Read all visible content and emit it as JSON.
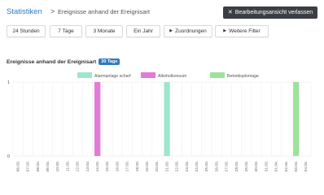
{
  "breadcrumb": {
    "root": "Statistiken",
    "separator": ">",
    "current": "Ereignisse anhand der Ereignisart"
  },
  "exit_button": {
    "icon": "close-icon",
    "label": "Bearbeitungsansicht verlassen"
  },
  "filters": [
    {
      "label": "24 Stunden"
    },
    {
      "label": "7 Tage"
    },
    {
      "label": "3 Monate"
    },
    {
      "label": "Ein Jahr"
    },
    {
      "label": "Zuordnungen",
      "icon": "caret-right-icon"
    },
    {
      "label": "Weitere Filter",
      "icon": "caret-right-icon"
    }
  ],
  "section": {
    "title": "Ereignisse anhand der Ereignisart",
    "badge": "30 Tage"
  },
  "colors": {
    "accent": "#2f7bbf",
    "dark_button": "#3b3f44",
    "grid": "#e6e6e6"
  },
  "chart_data": {
    "type": "bar",
    "title": "",
    "xlabel": "",
    "ylabel": "",
    "ylim": [
      0,
      1
    ],
    "yticks": [
      "0",
      "1"
    ],
    "legend_position": "top-center",
    "categories": [
      "06.03.",
      "07.03.",
      "08.03.",
      "09.03.",
      "10.03.",
      "11.03.",
      "12.03.",
      "13.03.",
      "14.03.",
      "15.03.",
      "16.03.",
      "17.03.",
      "18.03.",
      "19.03.",
      "20.03.",
      "21.03.",
      "22.03.",
      "23.03.",
      "24.03.",
      "25.03.",
      "26.03.",
      "27.03.",
      "28.03.",
      "29.03.",
      "30.03.",
      "31.03.",
      "01.04.",
      "02.04.",
      "03.04.",
      "04.04."
    ],
    "series": [
      {
        "name": "Alarmanlage scharf",
        "color": "#9ee6cc",
        "values": [
          0,
          0,
          0,
          0,
          0,
          0,
          0,
          0,
          0,
          0,
          0,
          0,
          0,
          0,
          0,
          1,
          0,
          0,
          0,
          0,
          0,
          0,
          0,
          0,
          0,
          0,
          0,
          0,
          0,
          0
        ]
      },
      {
        "name": "Alkoholkonsum",
        "color": "#e27ad6",
        "values": [
          0,
          0,
          0,
          0,
          0,
          0,
          0,
          0,
          1,
          0,
          0,
          0,
          0,
          0,
          0,
          0,
          0,
          0,
          0,
          0,
          0,
          0,
          0,
          0,
          0,
          0,
          0,
          0,
          0,
          0
        ]
      },
      {
        "name": "Betreibsplomage",
        "color": "#9be39a",
        "values": [
          0,
          0,
          0,
          0,
          0,
          0,
          0,
          0,
          0,
          0,
          0,
          0,
          0,
          0,
          0,
          0,
          0,
          0,
          0,
          0,
          0,
          0,
          0,
          0,
          0,
          0,
          0,
          0,
          1,
          0
        ]
      }
    ]
  }
}
